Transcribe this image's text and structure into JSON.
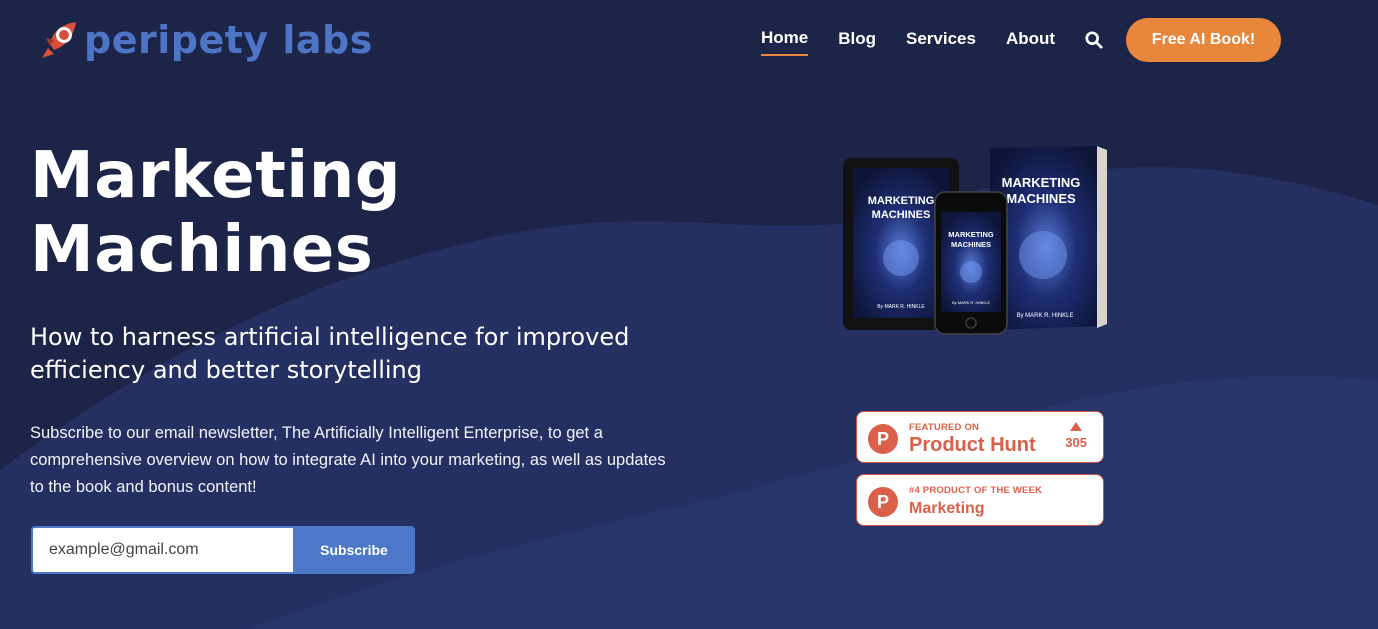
{
  "brand": {
    "name": "peripety labs",
    "accent": "#e8863b",
    "primary": "#4d77c9",
    "background": "#1c2447"
  },
  "nav": {
    "items": [
      {
        "label": "Home",
        "active": true
      },
      {
        "label": "Blog",
        "active": false
      },
      {
        "label": "Services",
        "active": false
      },
      {
        "label": "About",
        "active": false
      }
    ],
    "search_icon": "search-icon",
    "cta_label": "Free AI Book!"
  },
  "hero": {
    "title_line1": "Marketing",
    "title_line2": "Machines",
    "subtitle": "How to harness artificial intelligence for improved efficiency and better storytelling",
    "description": "Subscribe to our email newsletter,  The Artificially Intelligent Enterprise, to get a comprehensive overview on how to integrate AI into your marketing, as well as updates to the book and bonus content!"
  },
  "form": {
    "email_placeholder": "example@gmail.com",
    "submit_label": "Subscribe"
  },
  "mockup": {
    "book_title_line1": "MARKETING",
    "book_title_line2": "MACHINES",
    "author": "By MARK R. HINKLE"
  },
  "badges": [
    {
      "logo_letter": "P",
      "small": "FEATURED ON",
      "big": "Product Hunt",
      "votes": "305"
    },
    {
      "logo_letter": "P",
      "small": "#4 PRODUCT OF THE WEEK",
      "big": "Marketing"
    }
  ]
}
